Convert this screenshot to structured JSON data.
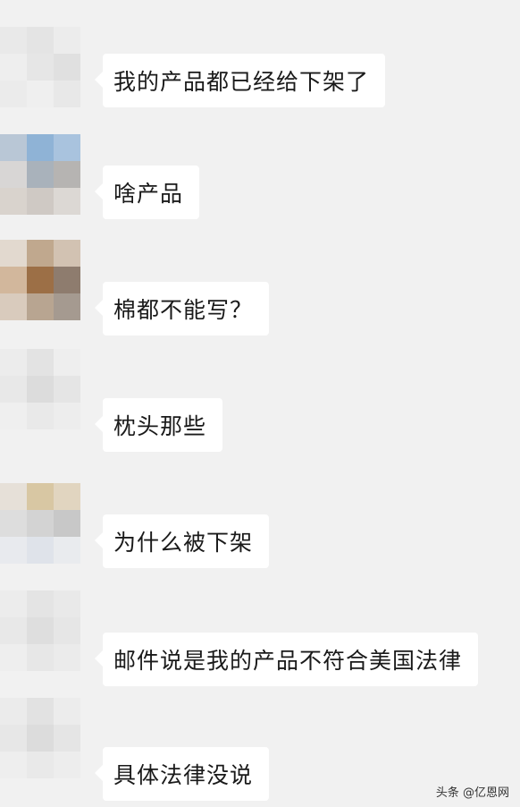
{
  "messages": [
    {
      "text": "我的产品都已经给下架了",
      "avatar_colors": [
        "#e9e9e9",
        "#e4e4e4",
        "#ececec",
        "#eeeeee",
        "#e6e6e6",
        "#e0e0e0",
        "#ebebeb",
        "#efefef",
        "#e8e8e8"
      ]
    },
    {
      "text": "啥产品",
      "avatar_colors": [
        "#b9c7d6",
        "#8fb3d6",
        "#a9c3de",
        "#d8d6d5",
        "#a9b2bb",
        "#b6b4b2",
        "#d9d3cd",
        "#cfc9c4",
        "#dcd8d4"
      ]
    },
    {
      "text": "棉都不能写？",
      "avatar_colors": [
        "#e2d9cf",
        "#c0a88e",
        "#d2c2b2",
        "#d2b79c",
        "#9c6f46",
        "#8e7c6e",
        "#d9cbbd",
        "#b8a591",
        "#a59a90"
      ]
    },
    {
      "text": "枕头那些",
      "avatar_colors": [
        "#ececec",
        "#e3e3e3",
        "#eeeeee",
        "#e8e8e8",
        "#dcdcdc",
        "#e5e5e5",
        "#efefef",
        "#e9e9e9",
        "#ededed"
      ]
    },
    {
      "text": "为什么被下架",
      "avatar_colors": [
        "#e6e0d8",
        "#d8c7a3",
        "#e1d5c0",
        "#dddddd",
        "#d3d3d3",
        "#c8c8c8",
        "#e8eaee",
        "#dfe3ea",
        "#e9ebee"
      ]
    },
    {
      "text": "邮件说是我的产品不符合美国法律",
      "avatar_colors": [
        "#ececec",
        "#e4e4e4",
        "#e9e9e9",
        "#e8e8e8",
        "#dedede",
        "#e6e6e6",
        "#eeeeee",
        "#e7e7e7",
        "#ebebeb"
      ]
    },
    {
      "text": "具体法律没说",
      "avatar_colors": [
        "#ebebeb",
        "#e2e2e2",
        "#ececec",
        "#e7e7e7",
        "#dcdcdc",
        "#e5e5e5",
        "#eeeeee",
        "#e9e9e9",
        "#ededed"
      ]
    }
  ],
  "watermark": "头条 @亿恩网"
}
